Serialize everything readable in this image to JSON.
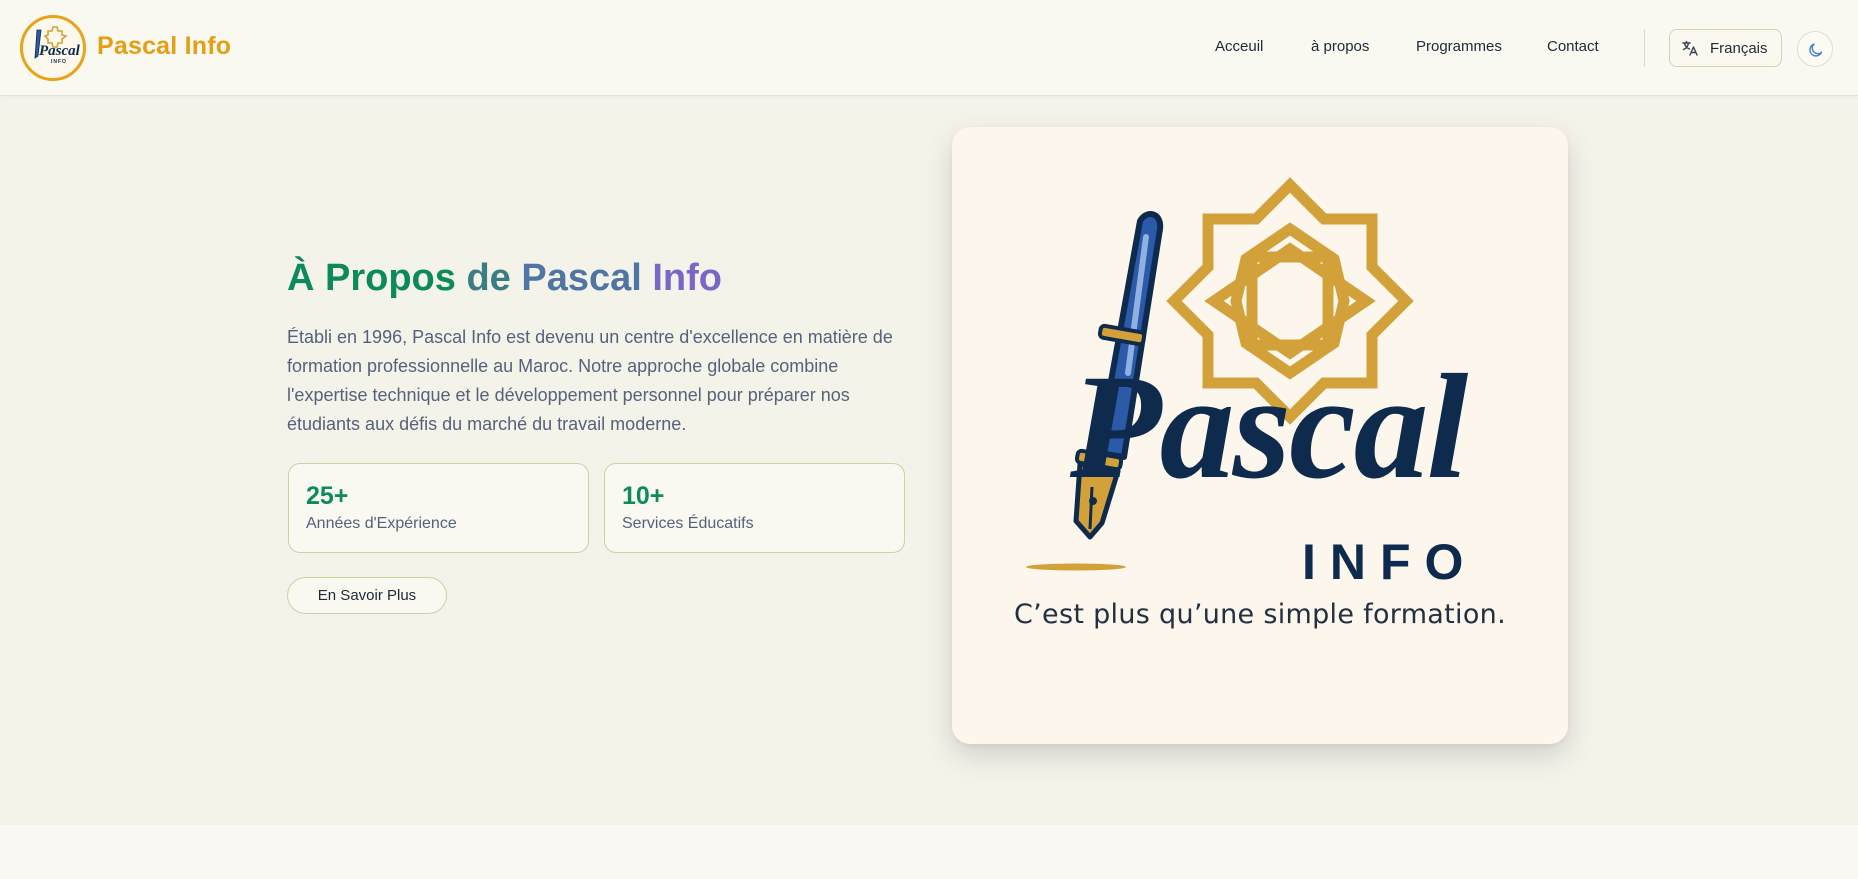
{
  "header": {
    "brand_name": "Pascal Info",
    "nav": [
      {
        "label": "Acceuil"
      },
      {
        "label": "à propos"
      },
      {
        "label": "Programmes"
      },
      {
        "label": "Contact"
      }
    ],
    "language": {
      "label": "Français",
      "icon": "translate-icon"
    },
    "theme_toggle": {
      "icon": "moon-icon"
    }
  },
  "hero": {
    "title_parts": [
      "À Propos ",
      "de ",
      "Pascal ",
      "Info"
    ],
    "description": "Établi en 1996, Pascal Info est devenu un centre d'excellence en matière de formation professionnelle au Maroc. Notre approche globale combine l'expertise technique et le développement personnel pour préparer nos étudiants aux défis du marché du travail moderne.",
    "stats": [
      {
        "value": "25+",
        "label": "Années d'Expérience"
      },
      {
        "value": "10+",
        "label": "Services Éducatifs"
      }
    ],
    "cta_label": "En Savoir Plus"
  },
  "logo_card": {
    "script_text": "Pascal",
    "sub_text": "INFO",
    "tagline": "C’est plus qu’une simple formation."
  },
  "colors": {
    "brand": "#e49f12",
    "accent_green": "#0d8a5c",
    "navy": "#0e2a4d",
    "gold": "#d3a13a",
    "pen_blue": "#2b5aa8"
  }
}
